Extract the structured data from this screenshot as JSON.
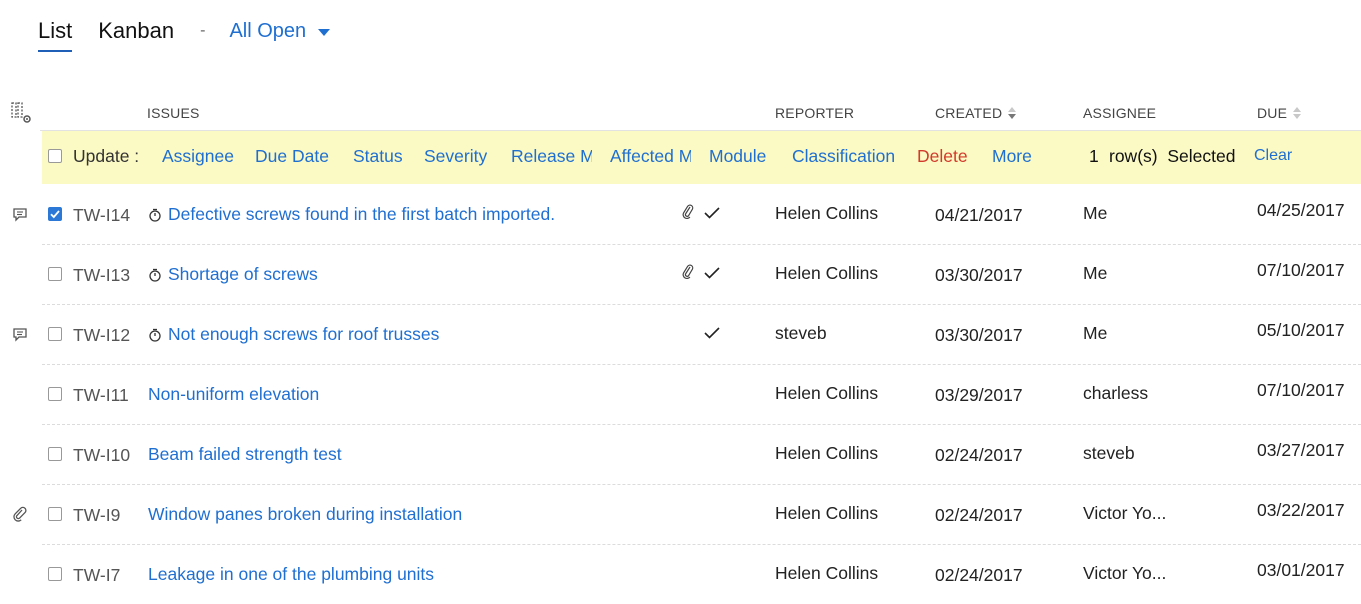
{
  "views": {
    "tabs": [
      "List",
      "Kanban"
    ],
    "separator": "-",
    "filter": "All Open"
  },
  "columns": {
    "issues": "ISSUES",
    "reporter": "REPORTER",
    "created": "CREATED",
    "assignee": "ASSIGNEE",
    "due": "DUE"
  },
  "bulk": {
    "update_label": "Update :",
    "actions": [
      "Assignee",
      "Due Date",
      "Status",
      "Severity",
      "Release M",
      "Affected M",
      "Module",
      "Classification"
    ],
    "delete": "Delete",
    "more": "More",
    "selected_count": "1",
    "selected_text": "row(s)  Selected",
    "clear": "Clear"
  },
  "rows": [
    {
      "id": "TW-I14",
      "title": "Defective screws found in the first batch imported.",
      "reporter": "Helen Collins",
      "created": "04/21/2017",
      "assignee": "Me",
      "due": "04/25/2017"
    },
    {
      "id": "TW-I13",
      "title": "Shortage of screws",
      "reporter": "Helen Collins",
      "created": "03/30/2017",
      "assignee": "Me",
      "due": "07/10/2017"
    },
    {
      "id": "TW-I12",
      "title": "Not enough screws for roof trusses",
      "reporter": "steveb",
      "created": "03/30/2017",
      "assignee": "Me",
      "due": "05/10/2017"
    },
    {
      "id": "TW-I11",
      "title": "Non-uniform elevation",
      "reporter": "Helen Collins",
      "created": "03/29/2017",
      "assignee": "charless",
      "due": "07/10/2017"
    },
    {
      "id": "TW-I10",
      "title": "Beam failed strength test",
      "reporter": "Helen Collins",
      "created": "02/24/2017",
      "assignee": "steveb",
      "due": "03/27/2017"
    },
    {
      "id": "TW-I9",
      "title": "Window panes broken during installation",
      "reporter": "Helen Collins",
      "created": "02/24/2017",
      "assignee": "Victor Yo...",
      "due": "03/22/2017"
    },
    {
      "id": "TW-I7",
      "title": "Leakage in one of the plumbing units",
      "reporter": "Helen Collins",
      "created": "02/24/2017",
      "assignee": "Victor Yo...",
      "due": "03/01/2017"
    }
  ],
  "colors": {
    "link": "#1f6fd1",
    "bulk_bg": "#fbf9c4",
    "delete": "#d23a2b",
    "checkbox": "#2b78d6"
  }
}
